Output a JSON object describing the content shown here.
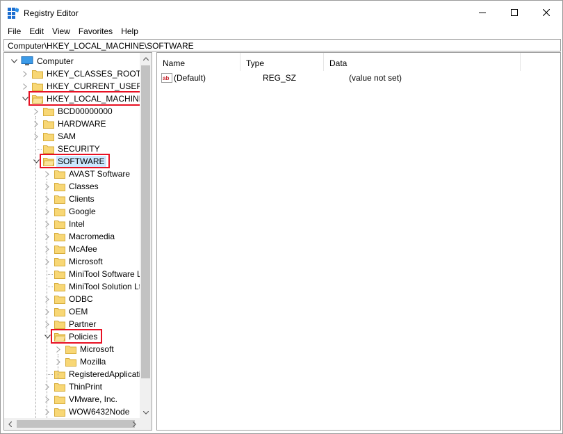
{
  "window": {
    "title": "Registry Editor",
    "icon": "registry-editor-icon",
    "controls": [
      "minimize-icon",
      "maximize-icon",
      "close-icon"
    ]
  },
  "menu": [
    "File",
    "Edit",
    "View",
    "Favorites",
    "Help"
  ],
  "address": "Computer\\HKEY_LOCAL_MACHINE\\SOFTWARE",
  "tree": {
    "root": "Computer",
    "hives": [
      "HKEY_CLASSES_ROOT",
      "HKEY_CURRENT_USER",
      "HKEY_LOCAL_MACHINE"
    ],
    "hklm_children": [
      "BCD00000000",
      "HARDWARE",
      "SAM",
      "SECURITY",
      "SOFTWARE"
    ],
    "software_children": [
      "AVAST Software",
      "Classes",
      "Clients",
      "Google",
      "Intel",
      "Macromedia",
      "McAfee",
      "Microsoft",
      "MiniTool Software Li",
      "MiniTool Solution Lt",
      "ODBC",
      "OEM",
      "Partner",
      "Policies"
    ],
    "policies_children": [
      "Microsoft",
      "Mozilla"
    ],
    "software_children_after": [
      "RegisteredApplicatic",
      "ThinPrint",
      "VMware, Inc.",
      "WOW6432Node"
    ],
    "selected": "SOFTWARE",
    "highlighted": [
      "HKEY_LOCAL_MACHINE",
      "SOFTWARE",
      "Policies"
    ]
  },
  "list": {
    "columns": [
      "Name",
      "Type",
      "Data"
    ],
    "rows": [
      {
        "name": "(Default)",
        "type": "REG_SZ",
        "data": "(value not set)",
        "icon": "string-value-icon"
      }
    ]
  },
  "colors": {
    "highlight_border": "#e81123",
    "selection": "#cce8ff",
    "folder": "#f8d775"
  }
}
